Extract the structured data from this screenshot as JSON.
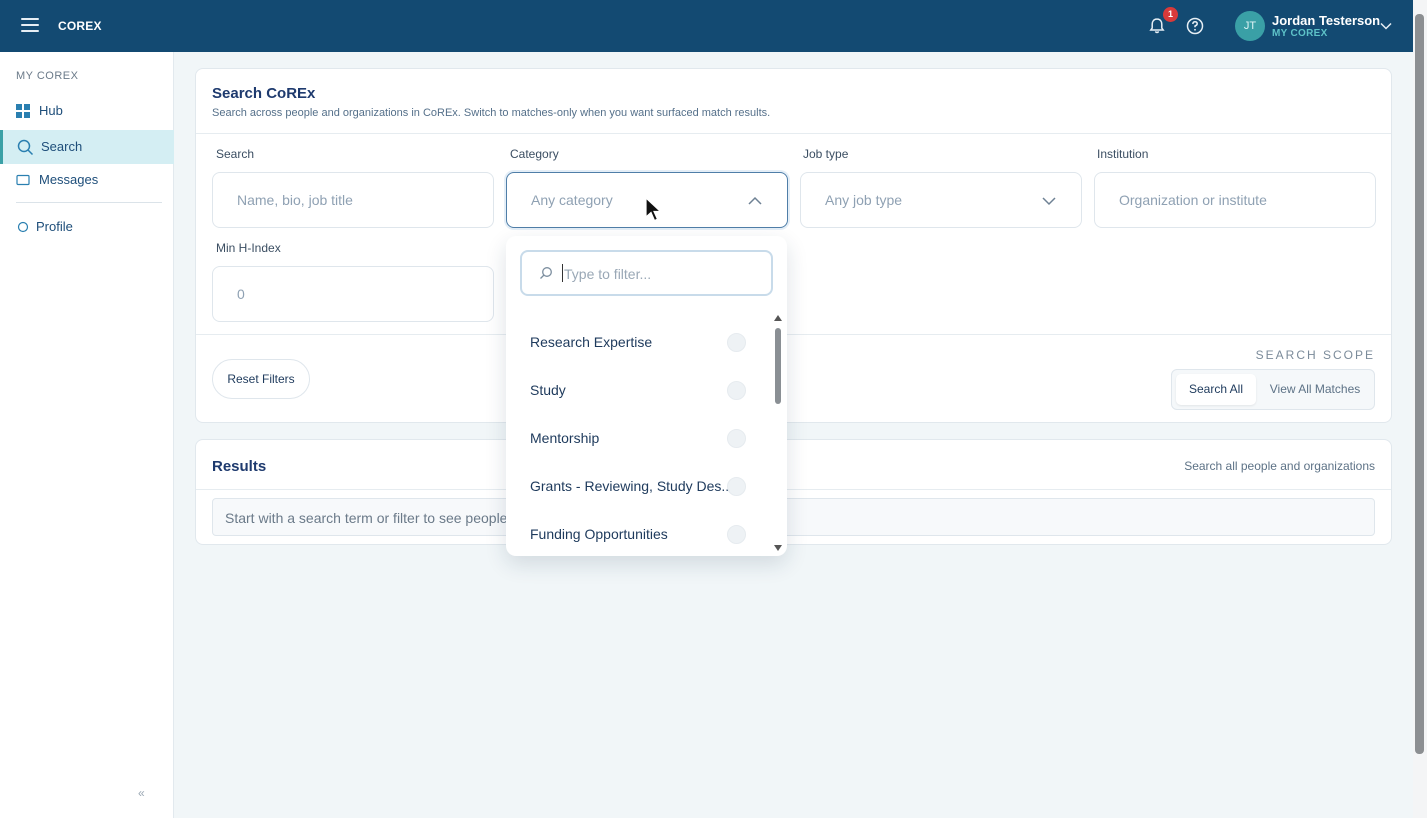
{
  "header": {
    "brand": "COREX",
    "notification_count": "1",
    "user_initials": "JT",
    "user_name": "Jordan Testerson",
    "user_sub": "MY COREX"
  },
  "sidebar": {
    "heading": "MY COREX",
    "items": [
      {
        "label": "Hub",
        "icon": "grid-icon"
      },
      {
        "label": "Search",
        "icon": "search-icon"
      },
      {
        "label": "Messages",
        "icon": "message-icon"
      },
      {
        "label": "Profile",
        "icon": "circle-icon"
      }
    ],
    "collapse_label": "«"
  },
  "search_panel": {
    "title": "Search CoREx",
    "subtitle": "Search across people and organizations in CoREx. Switch to matches-only when you want surfaced match results.",
    "fields": {
      "search": {
        "label": "Search",
        "placeholder": "Name, bio, job title"
      },
      "category": {
        "label": "Category",
        "placeholder": "Any category"
      },
      "job_type": {
        "label": "Job type",
        "placeholder": "Any job type"
      },
      "institution": {
        "label": "Institution",
        "placeholder": "Organization or institute"
      },
      "min_h_index": {
        "label": "Min H-Index",
        "value": "0"
      }
    },
    "reset_label": "Reset Filters",
    "scope_label": "SEARCH SCOPE",
    "scope_options": [
      "Search All",
      "View All Matches"
    ],
    "scope_selected": "Search All"
  },
  "results": {
    "title": "Results",
    "hint": "Search all people and organizations",
    "empty_text": "Start with a search term or filter to see people"
  },
  "category_dropdown": {
    "filter_placeholder": "Type to filter...",
    "options": [
      "Research Expertise",
      "Study",
      "Mentorship",
      "Grants - Reviewing, Study Des...",
      "Funding Opportunities"
    ]
  },
  "colors": {
    "topbar": "#134a72",
    "accent": "#3aa0a6",
    "active_nav_bg": "#d4eef3",
    "badge": "#d83a3a"
  }
}
